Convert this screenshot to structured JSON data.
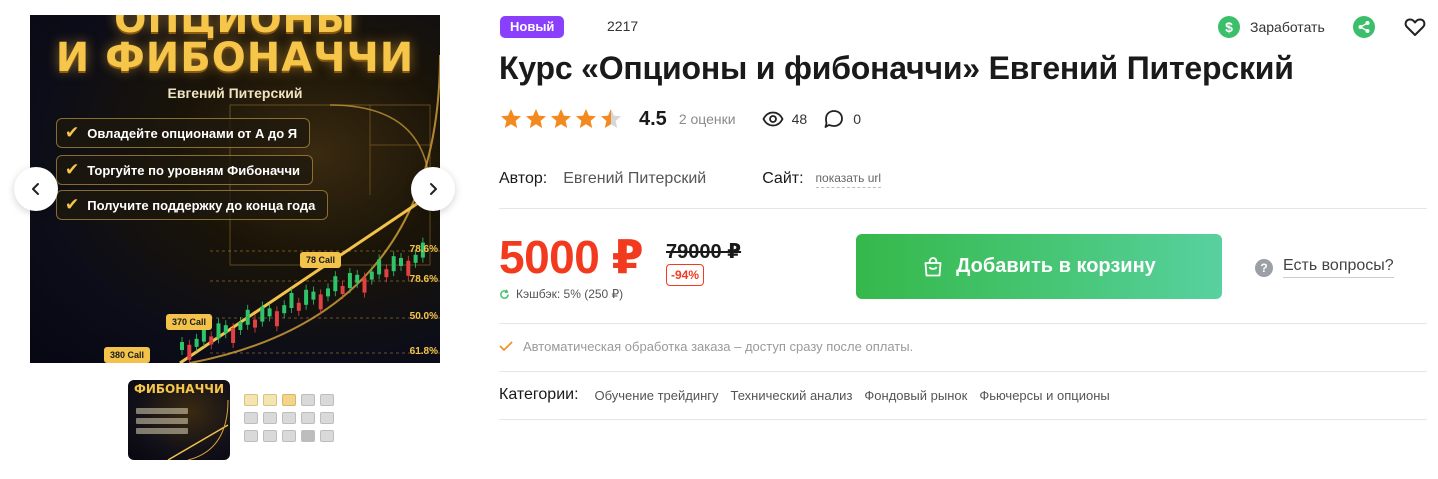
{
  "gallery": {
    "cover": {
      "title_line1": "ОПЦИОНЫ",
      "title_line2": "И ФИБОНАЧЧИ",
      "author": "Евгений Питерский",
      "points": [
        "Овладейте опционами от А до Я",
        "Торгуйте по уровням Фибоначчи",
        "Получите поддержку до конца года"
      ],
      "call_labels": [
        "78 Call",
        "370 Call",
        "380 Call"
      ],
      "fib_levels": [
        "78.6%",
        "78.6%",
        "50.0%",
        "61.8%"
      ]
    },
    "prev_icon": "chevron-left-icon",
    "next_icon": "chevron-right-icon",
    "thumbnail_title": "ФИБОНАЧЧИ"
  },
  "header": {
    "badge": "Новый",
    "sku": "2217",
    "earn_label": "Заработать",
    "earn_icon_glyph": "$"
  },
  "product": {
    "title": "Курс «Опционы и фибоначчи» Евгений Питерский",
    "rating": {
      "stars": 4.5,
      "value": "4.5",
      "count_label": "2 оценки"
    },
    "views": "48",
    "comments": "0",
    "author_label": "Автор:",
    "author_value": "Евгений Питерский",
    "site_label": "Сайт:",
    "site_link": "показать url"
  },
  "pricing": {
    "price": "5000 ₽",
    "old_price": "79000 ₽",
    "discount": "-94%",
    "cashback": "Кэшбэк: 5% (250 ₽)",
    "cart_button": "Добавить в корзину",
    "questions_label": "Есть вопросы?",
    "questions_glyph": "?"
  },
  "notice": {
    "text": "Автоматическая обработка заказа – доступ сразу после оплаты."
  },
  "categories": {
    "label": "Категории:",
    "items": [
      "Обучение трейдингу",
      "Технический анализ",
      "Фондовый рынок",
      "Фьючерсы и опционы"
    ]
  },
  "colors": {
    "accent_red": "#f23a1f",
    "badge_purple": "#8a3ffc",
    "cart_green": "#3cbf6b",
    "star_orange": "#f28a1f"
  }
}
